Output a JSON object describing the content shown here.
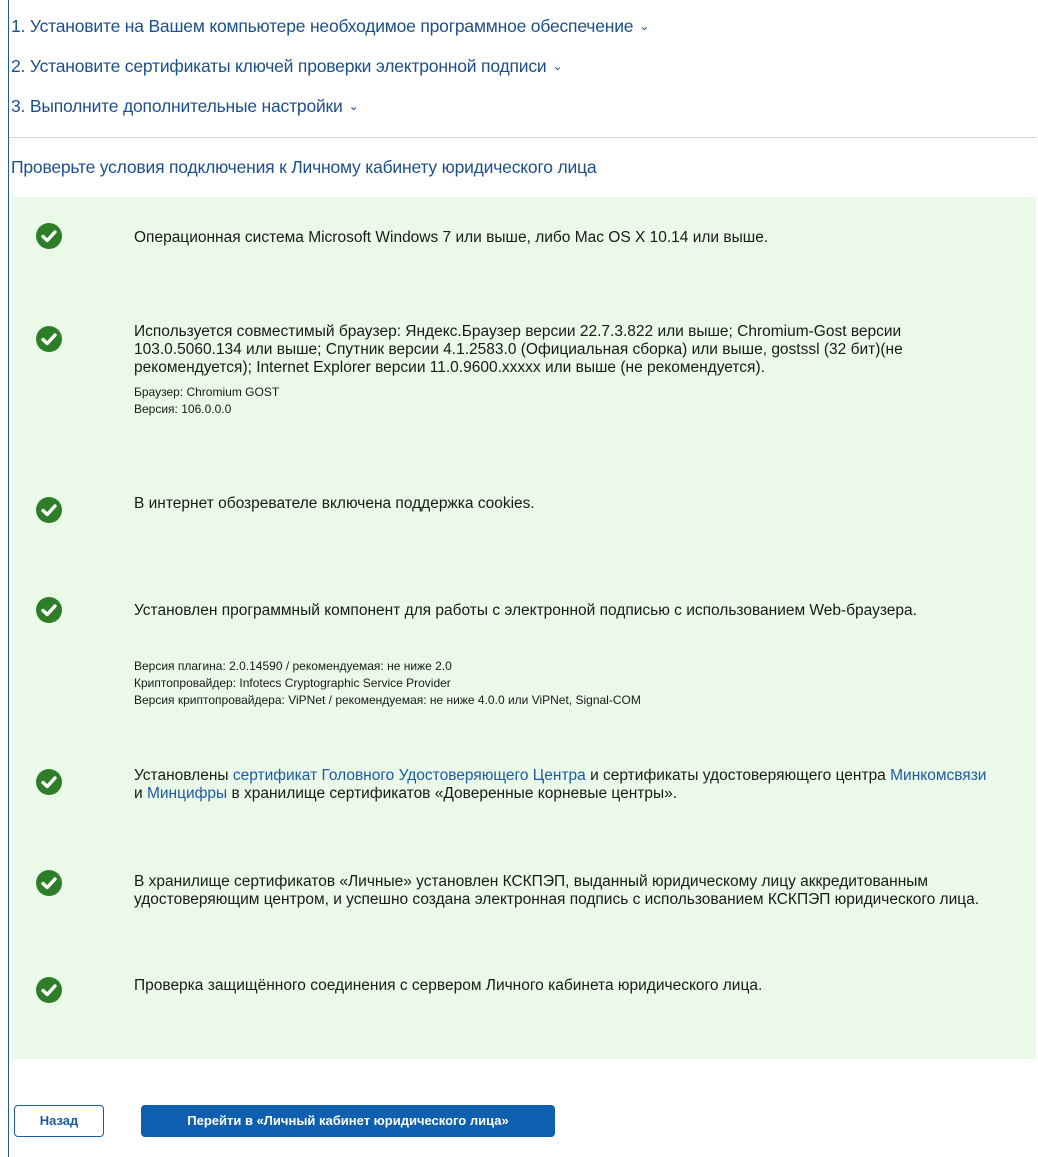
{
  "steps": [
    {
      "label": "1. Установите на Вашем компьютере необходимое программное обеспечение"
    },
    {
      "label": "2. Установите сертификаты ключей проверки электронной подписи"
    },
    {
      "label": "3. Выполните дополнительные настройки"
    }
  ],
  "check_title": "Проверьте условия подключения к Личному кабинету юридического лица",
  "checks": [
    {
      "status": "ok",
      "text": "Операционная система Microsoft Windows 7 или выше, либо Mac OS X 10.14 или выше."
    },
    {
      "status": "ok",
      "text": "Используется совместимый браузер: Яндекс.Браузер версии 22.7.3.822 или выше; Chromium-Gost версии 103.0.5060.134 или выше; Спутник версии 4.1.2583.0 (Официальная сборка) или выше, gostssl (32 бит)(не рекомендуется); Internet Explorer версии 11.0.9600.xxxxx или выше (не рекомендуется).",
      "details": [
        "Браузер: Chromium GOST",
        "Версия: 106.0.0.0"
      ]
    },
    {
      "status": "ok",
      "text": "В интернет обозревателе включена поддержка cookies."
    },
    {
      "status": "ok",
      "text": "Установлен программный компонент для работы с электронной подписью с использованием Web-браузера.",
      "details": [
        "Версия плагина: 2.0.14590 / рекомендуемая: не ниже 2.0",
        "Криптопровайдер: Infotecs Cryptographic Service Provider",
        "Версия криптопровайдера: ViPNet / рекомендуемая: не ниже 4.0.0 или ViPNet, Signal-COM"
      ]
    },
    {
      "status": "ok",
      "text_parts": {
        "p1": "Установлены ",
        "link1": "сертификат Головного Удостоверяющего Центра",
        "p2": " и сертификаты удостоверяющего центра ",
        "link2": "Минкомсвязи",
        "p3": " и ",
        "link3": "Минцифры",
        "p4": " в хранилище сертификатов «Доверенные корневые центры»."
      }
    },
    {
      "status": "ok",
      "text": "В хранилище сертификатов «Личные» установлен КСКПЭП, выданный юридическому лицу аккредитованным удостоверяющим центром, и успешно создана электронная подпись с использованием КСКПЭП юридического лица."
    },
    {
      "status": "ok",
      "text": "Проверка защищённого соединения с сервером Личного кабинета юридического лица."
    }
  ],
  "buttons": {
    "back_label": "Назад",
    "go_label": "Перейти в «Личный кабинет юридического лица»"
  },
  "colors": {
    "link": "#1d5aa6",
    "success_bg": "#eaf9e8",
    "check_icon": "#2e7d28",
    "primary_button": "#0f5fb1"
  },
  "icons": {
    "step_toggle": "chevron-down-icon",
    "check_status": "check-circle-icon"
  }
}
